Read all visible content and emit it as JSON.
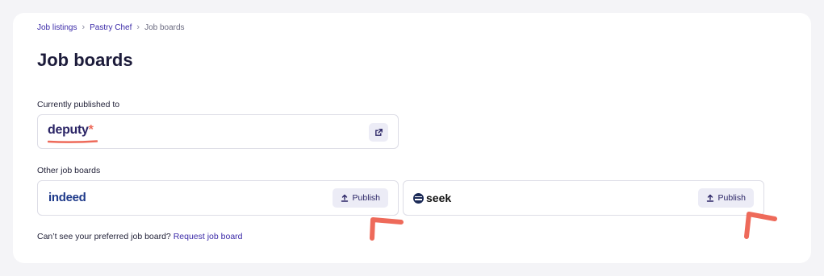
{
  "breadcrumb": {
    "items": [
      "Job listings",
      "Pastry Chef"
    ],
    "current": "Job boards"
  },
  "page": {
    "title": "Job boards"
  },
  "published": {
    "label": "Currently published to",
    "board": {
      "name": "deputy",
      "star": "*"
    }
  },
  "other": {
    "label": "Other job boards",
    "boards": [
      {
        "name": "indeed",
        "publish_label": "Publish"
      },
      {
        "name": "seek",
        "publish_label": "Publish"
      }
    ]
  },
  "footer": {
    "text": "Can’t see your preferred job board?",
    "link": "Request job board"
  },
  "colors": {
    "accent": "#3b2aa8",
    "annotation": "#ee6a5a",
    "button_bg": "#ececf6"
  }
}
